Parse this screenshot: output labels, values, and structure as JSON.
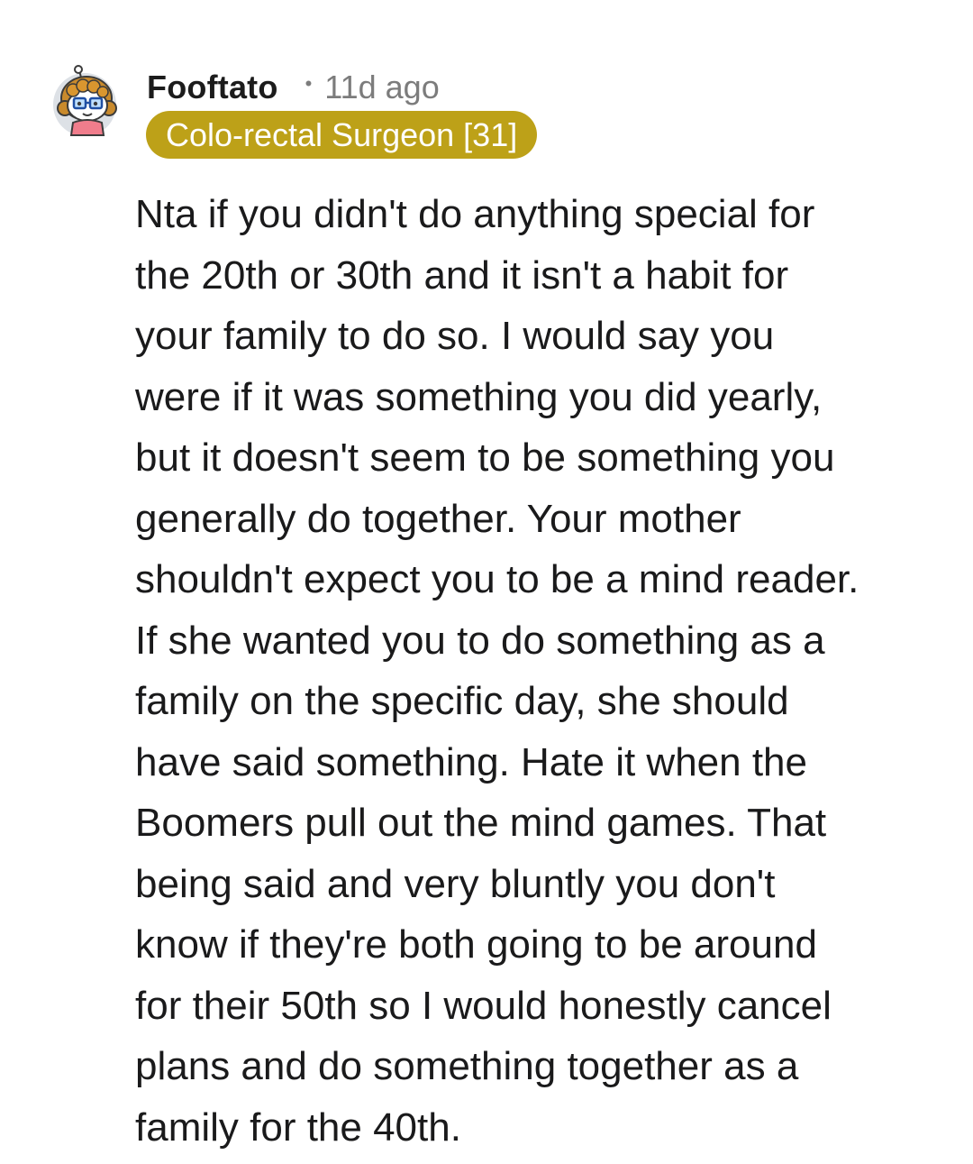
{
  "comment": {
    "author": "Fooftato",
    "separator": "•",
    "timestamp": "11d ago",
    "flair": {
      "text": "Colo-rectal Surgeon [31]",
      "background": "#bda118",
      "text_color": "#ffffff"
    },
    "avatar_icon": "snoo-avatar-icon",
    "body_lines": [
      "Nta if you didn't do anything special for",
      "the 20th or 30th and it isn't a habit for",
      "your family to do so. I would say you",
      "were if it was something you did yearly,",
      "but it doesn't seem to be something you",
      "generally do together. Your mother",
      "shouldn't expect you to be a mind reader.",
      "If she wanted you to do something as a",
      "family on the specific day, she should",
      "have said something. Hate it when the",
      "Boomers pull out the mind games. That",
      "being said and very bluntly you don't",
      "know if they're both going to be around",
      "for their 50th so I would honestly cancel",
      "plans and do something together as a",
      "family for the 40th."
    ]
  }
}
